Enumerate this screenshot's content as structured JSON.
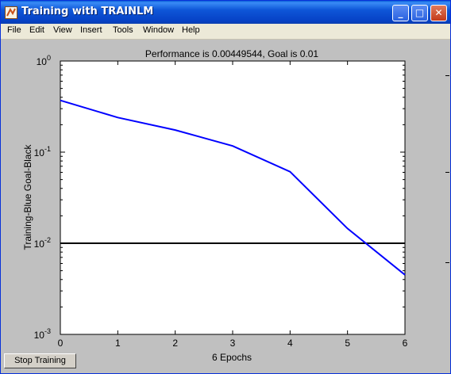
{
  "window": {
    "title": "Training with TRAINLM",
    "controls": {
      "minimize": "_",
      "maximize": "□",
      "close": "✕"
    }
  },
  "menu": [
    "File",
    "Edit",
    "View",
    "Insert",
    "Tools",
    "Window",
    "Help"
  ],
  "chart_data": {
    "type": "line",
    "title": "Performance is 0.00449544, Goal is 0.01",
    "xlabel": "6 Epochs",
    "ylabel": "Training-Blue  Goal-Black",
    "xlim": [
      0,
      6
    ],
    "ylim": [
      0.001,
      1
    ],
    "yscale": "log",
    "grid": false,
    "x_ticks": [
      "0",
      "1",
      "2",
      "3",
      "4",
      "5",
      "6"
    ],
    "y_ticks": [
      {
        "value": 1,
        "base": "10",
        "exp": "0"
      },
      {
        "value": 0.1,
        "base": "10",
        "exp": "-1"
      },
      {
        "value": 0.01,
        "base": "10",
        "exp": "-2"
      },
      {
        "value": 0.001,
        "base": "10",
        "exp": "-3"
      }
    ],
    "series": [
      {
        "name": "Training",
        "color": "#0000ff",
        "x": [
          0,
          1,
          2,
          3,
          4,
          5,
          6
        ],
        "y": [
          0.37,
          0.24,
          0.175,
          0.117,
          0.061,
          0.0145,
          0.0045
        ]
      },
      {
        "name": "Goal",
        "color": "#000000",
        "x": [
          0,
          6
        ],
        "y": [
          0.01,
          0.01
        ]
      }
    ]
  },
  "button": {
    "stop_label": "Stop Training"
  }
}
